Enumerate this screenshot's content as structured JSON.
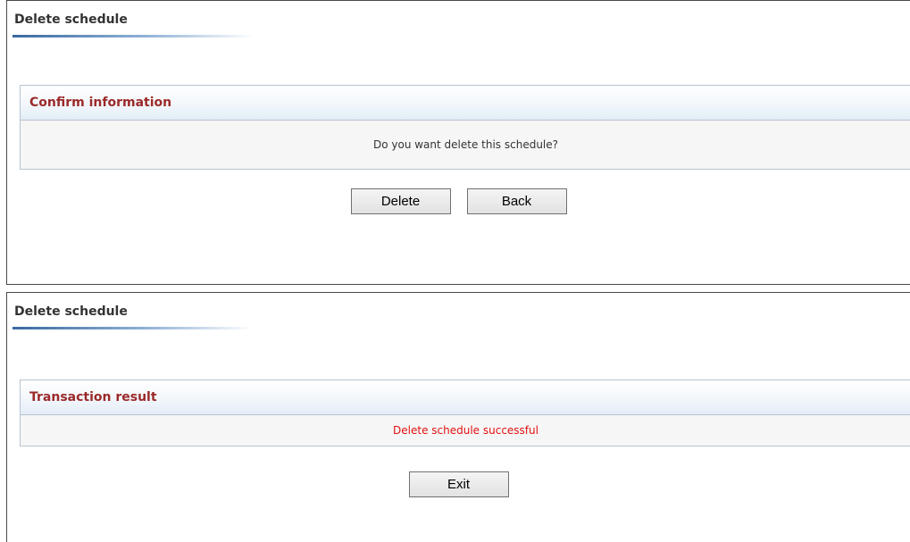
{
  "confirm_panel": {
    "title": "Delete schedule",
    "section_title": "Confirm information",
    "message": "Do you want delete this schedule?",
    "delete_label": "Delete",
    "back_label": "Back"
  },
  "result_panel": {
    "title": "Delete schedule",
    "section_title": "Transaction result",
    "message": "Delete schedule successful",
    "exit_label": "Exit"
  },
  "colors": {
    "section_title": "#9b2a2a",
    "success_message": "#e01010",
    "title_rule": "#3a6aa0"
  }
}
